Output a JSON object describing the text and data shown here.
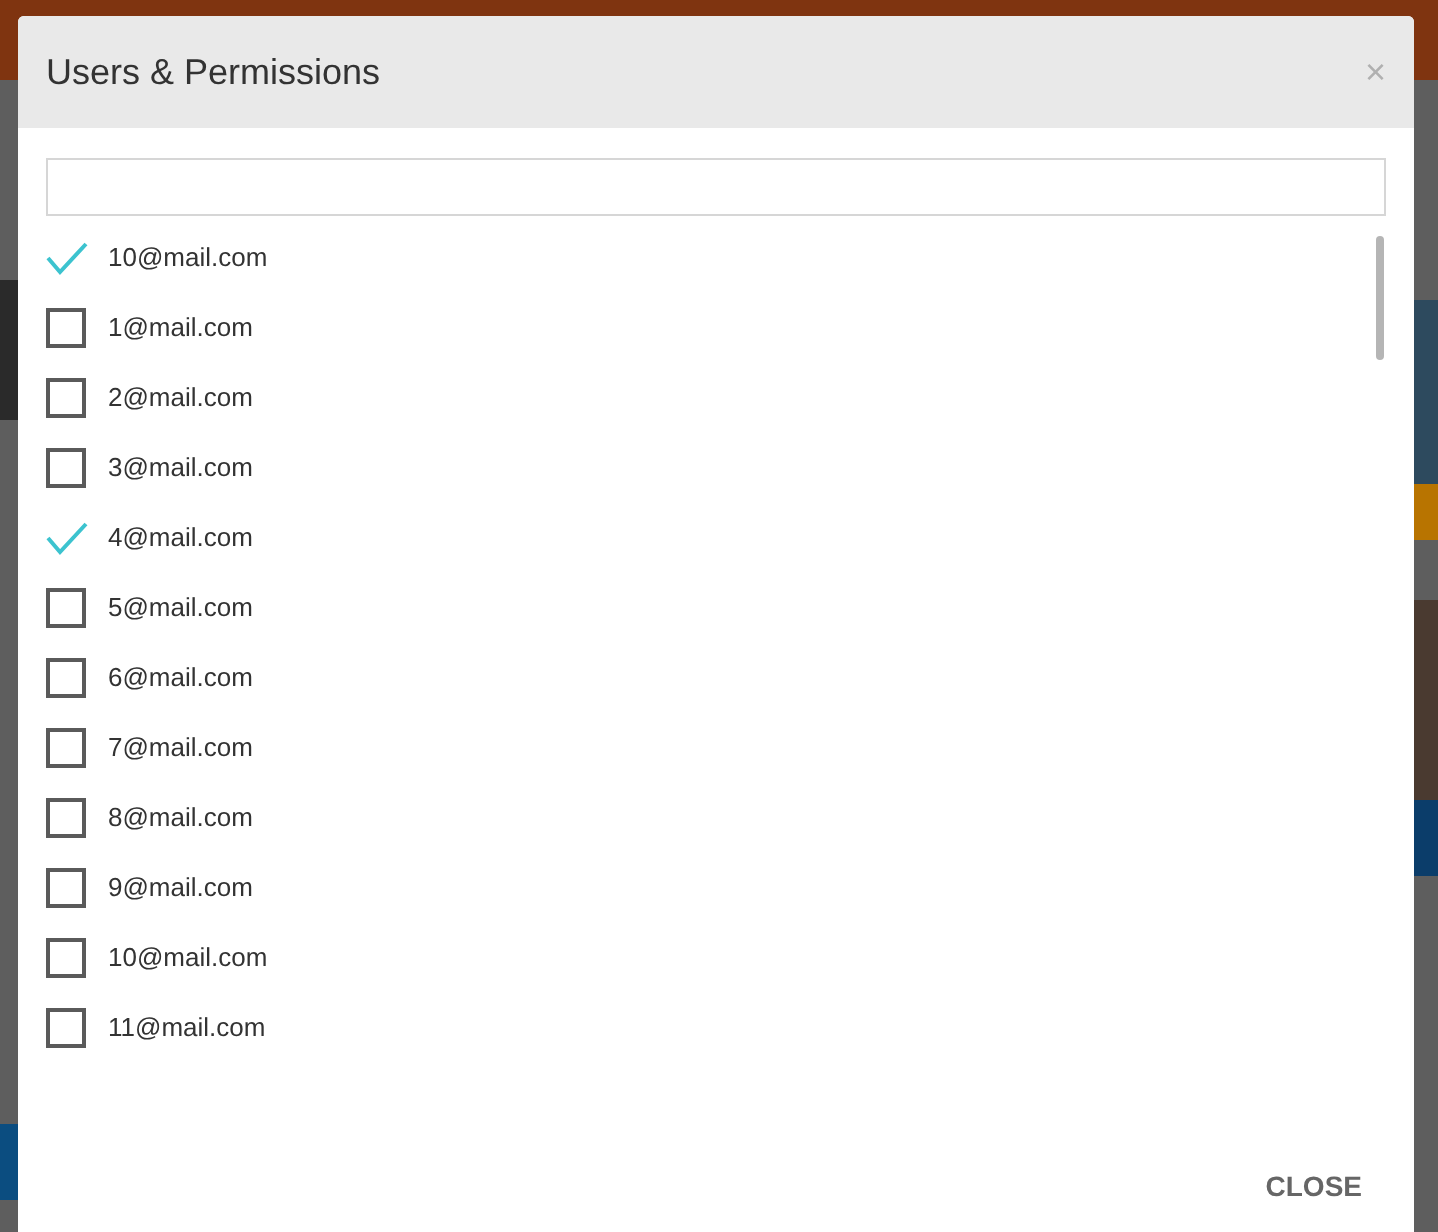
{
  "dialog": {
    "title": "Users & Permissions",
    "close_symbol": "×",
    "users": [
      {
        "email": "10@mail.com",
        "checked": true
      },
      {
        "email": "1@mail.com",
        "checked": false
      },
      {
        "email": "2@mail.com",
        "checked": false
      },
      {
        "email": "3@mail.com",
        "checked": false
      },
      {
        "email": "4@mail.com",
        "checked": true
      },
      {
        "email": "5@mail.com",
        "checked": false
      },
      {
        "email": "6@mail.com",
        "checked": false
      },
      {
        "email": "7@mail.com",
        "checked": false
      },
      {
        "email": "8@mail.com",
        "checked": false
      },
      {
        "email": "9@mail.com",
        "checked": false
      },
      {
        "email": "10@mail.com",
        "checked": false
      },
      {
        "email": "11@mail.com",
        "checked": false
      }
    ],
    "buttons": [
      "CLOSE"
    ]
  }
}
